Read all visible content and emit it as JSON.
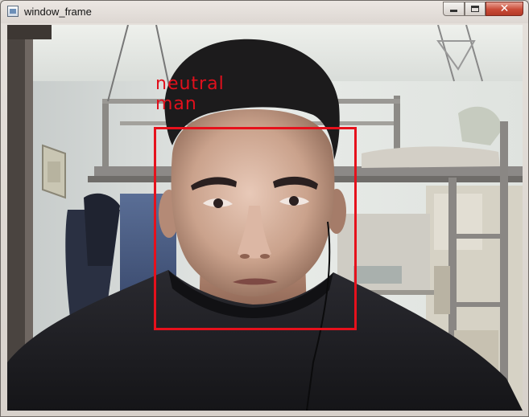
{
  "window": {
    "title": "window_frame",
    "controls": {
      "minimize": "minimize",
      "maximize": "maximize",
      "close": "close"
    }
  },
  "detection": {
    "labels": [
      "neutral",
      "man"
    ],
    "box_color": "#e6111c",
    "text_color": "#e0101c"
  },
  "icons": {
    "app": "window-app-icon",
    "minimize": "minimize-icon",
    "maximize": "maximize-icon",
    "close": "close-icon"
  }
}
